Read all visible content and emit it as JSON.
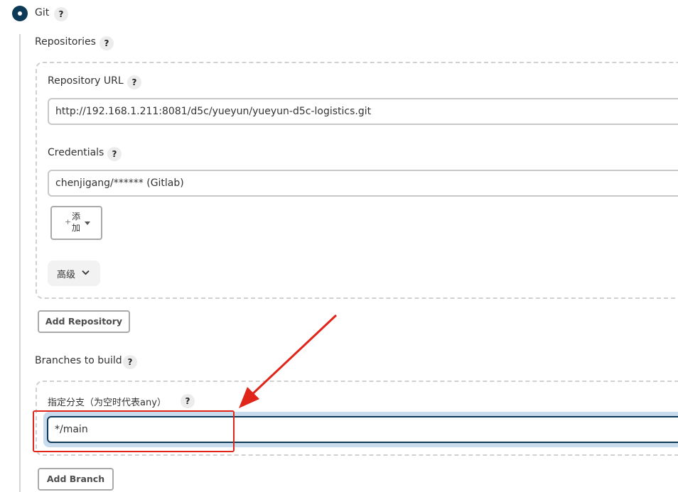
{
  "scm": {
    "label": "Git",
    "help": "?"
  },
  "repositories": {
    "label": "Repositories",
    "help": "?",
    "repository_url": {
      "label": "Repository URL",
      "help": "?",
      "value": "http://192.168.1.211:8081/d5c/yueyun/yueyun-d5c-logistics.git"
    },
    "credentials": {
      "label": "Credentials",
      "help": "?",
      "value": "chenjigang/****** (Gitlab)"
    },
    "add_button": {
      "plus": "+",
      "line1": "添",
      "line2": "加"
    },
    "advanced_label": "高级",
    "add_repository_label": "Add Repository"
  },
  "branches": {
    "label": "Branches to build",
    "help": "?",
    "branch_specifier": {
      "label": "指定分支（为空时代表any）",
      "help": "?",
      "value": "*/main"
    },
    "add_branch_label": "Add Branch"
  },
  "colors": {
    "radio": "#0d3b57",
    "annotation": "#e0251b",
    "focus": "#0d3b57"
  }
}
